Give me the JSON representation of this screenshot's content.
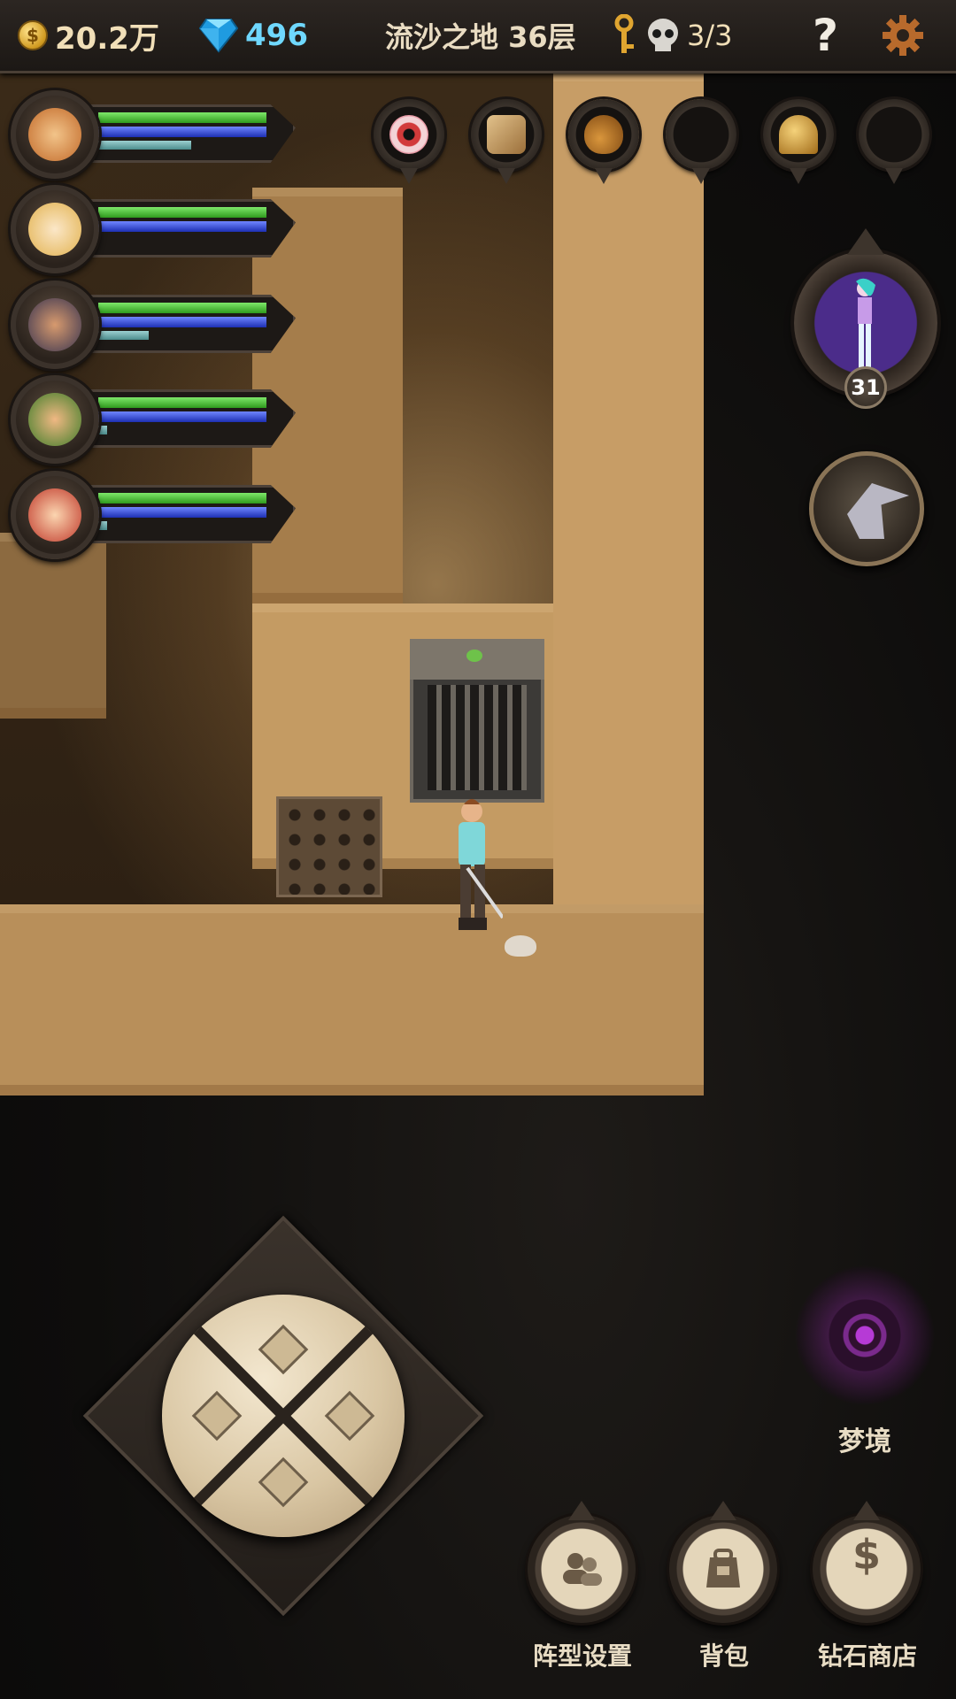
{
  "topbar": {
    "gold": "20.2万",
    "gold_icon": "$",
    "gems": "496",
    "location": "流沙之地 36层",
    "kills": "3/3",
    "help": "?"
  },
  "party": [
    {
      "name_icon": "hero-portrait-1",
      "hp": 1.0,
      "mp": 1.0,
      "xp": 0.55
    },
    {
      "name_icon": "hero-portrait-2",
      "hp": 1.0,
      "mp": 1.0,
      "xp": 0.0
    },
    {
      "name_icon": "hero-portrait-3",
      "hp": 1.0,
      "mp": 1.0,
      "xp": 0.3
    },
    {
      "name_icon": "hero-portrait-4",
      "hp": 1.0,
      "mp": 1.0,
      "xp": 0.05
    },
    {
      "name_icon": "hero-portrait-5",
      "hp": 1.0,
      "mp": 1.0,
      "xp": 0.05
    }
  ],
  "items": [
    "eye-icon",
    "rune-dice-icon",
    "acorn-icon",
    "empty-slot",
    "bell-icon",
    "empty-slot"
  ],
  "pet": {
    "level": "31"
  },
  "dream_label": "梦境",
  "buttons": {
    "formation": "阵型设置",
    "bag": "背包",
    "shop": "钻石商店",
    "shop_glyph": "$"
  },
  "colors": {
    "hp": "#3fb32a",
    "mp": "#2b46d6",
    "xp": "#6fb0b0",
    "gem": "#48c8ff",
    "accent_dream": "#b63ad6"
  }
}
